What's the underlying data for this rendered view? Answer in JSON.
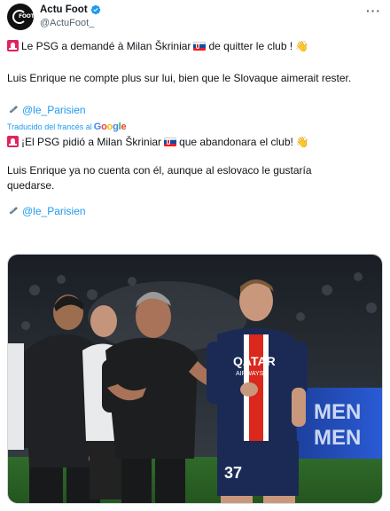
{
  "tweet": {
    "author": {
      "display_name": "Actu Foot",
      "handle": "@ActuFoot_",
      "avatar_text": "FOOT",
      "verified": true
    },
    "more_label": "···",
    "original": {
      "line1": "Le PSG a demandé à Milan Škriniar",
      "line1_tail": "de quitter le club !",
      "line2": "Luis Enrique ne compte plus sur lui, bien que le Slovaque aimerait rester.",
      "source": "@le_Parisien"
    },
    "translation": {
      "label": "Traducido del francés al",
      "provider": "Google",
      "line1": "¡El PSG pidió a Milan Škriniar",
      "line1_tail": "que abandonara el club!",
      "line2": "Luis Enrique ya no cuenta con él, aunque al eslovaco le gustaría quedarse.",
      "source": "@le_Parisien"
    },
    "media": {
      "shirt_sponsor": "QATAR",
      "shirt_sponsor_sub": "AIRWAYS",
      "shirt_number": "37",
      "board_text_1": "MEN",
      "board_text_2": "MEN"
    },
    "icons": {
      "verified": "verified-badge-icon",
      "siren": "siren-icon",
      "flag": "slovakia-flag-icon",
      "wave": "waving-hand-icon",
      "pin": "paperclip-icon",
      "more": "more-options-icon"
    },
    "colors": {
      "accent": "#1d9bf0",
      "text": "#0f1419",
      "muted": "#536471",
      "psg_navy": "#1b2a55",
      "psg_red": "#da291c"
    }
  }
}
